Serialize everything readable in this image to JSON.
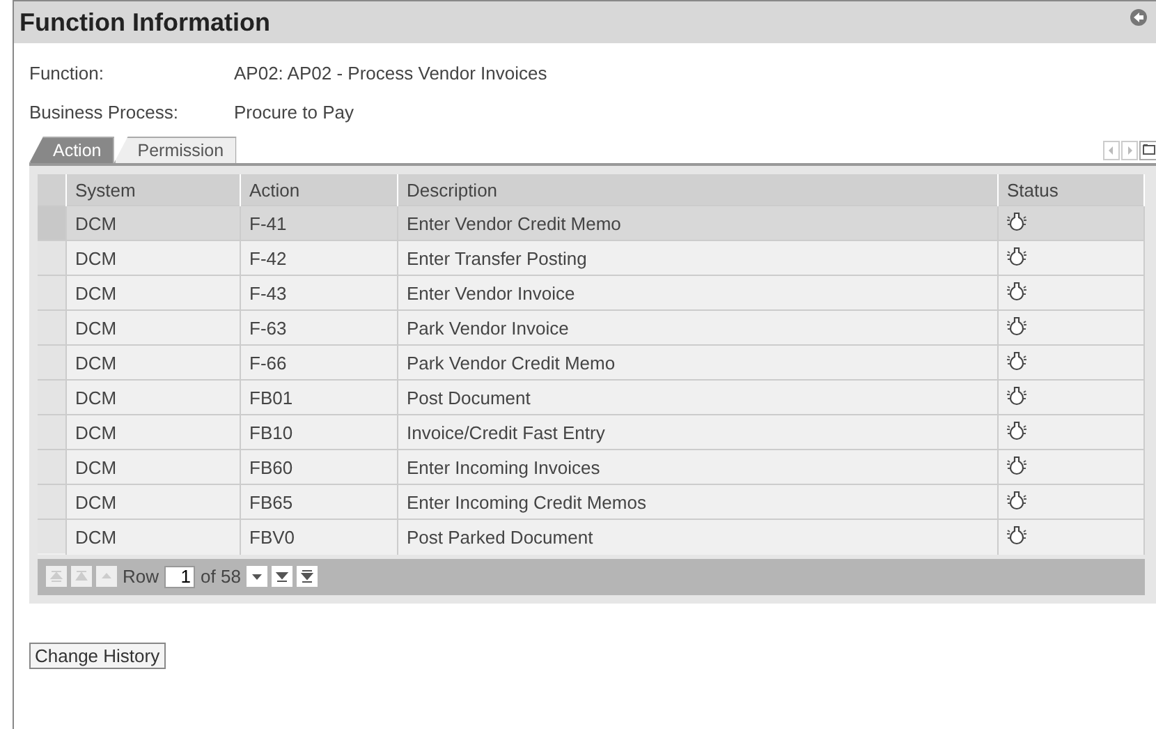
{
  "title": "Function Information",
  "fields": [
    {
      "label": "Function:",
      "value": "AP02: AP02 - Process Vendor Invoices"
    },
    {
      "label": "Business Process:",
      "value": "Procure to Pay"
    }
  ],
  "tabs": [
    {
      "label": "Action",
      "selected": true
    },
    {
      "label": "Permission",
      "selected": false
    }
  ],
  "table": {
    "columns": [
      "System",
      "Action",
      "Description",
      "Status"
    ],
    "rows": [
      {
        "system": "DCM",
        "action": "F-41",
        "description": "Enter Vendor Credit Memo",
        "selected": true
      },
      {
        "system": "DCM",
        "action": "F-42",
        "description": "Enter Transfer Posting",
        "selected": false
      },
      {
        "system": "DCM",
        "action": "F-43",
        "description": "Enter Vendor Invoice",
        "selected": false
      },
      {
        "system": "DCM",
        "action": "F-63",
        "description": "Park Vendor Invoice",
        "selected": false
      },
      {
        "system": "DCM",
        "action": "F-66",
        "description": "Park Vendor Credit Memo",
        "selected": false
      },
      {
        "system": "DCM",
        "action": "FB01",
        "description": "Post Document",
        "selected": false
      },
      {
        "system": "DCM",
        "action": "FB10",
        "description": "Invoice/Credit Fast Entry",
        "selected": false
      },
      {
        "system": "DCM",
        "action": "FB60",
        "description": "Enter Incoming Invoices",
        "selected": false
      },
      {
        "system": "DCM",
        "action": "FB65",
        "description": "Enter Incoming Credit Memos",
        "selected": false
      },
      {
        "system": "DCM",
        "action": "FBV0",
        "description": "Post Parked Document",
        "selected": false
      }
    ]
  },
  "pager": {
    "row_label": "Row",
    "row_value": "1",
    "of_label": "of 58"
  },
  "buttons": [
    "Change History"
  ]
}
